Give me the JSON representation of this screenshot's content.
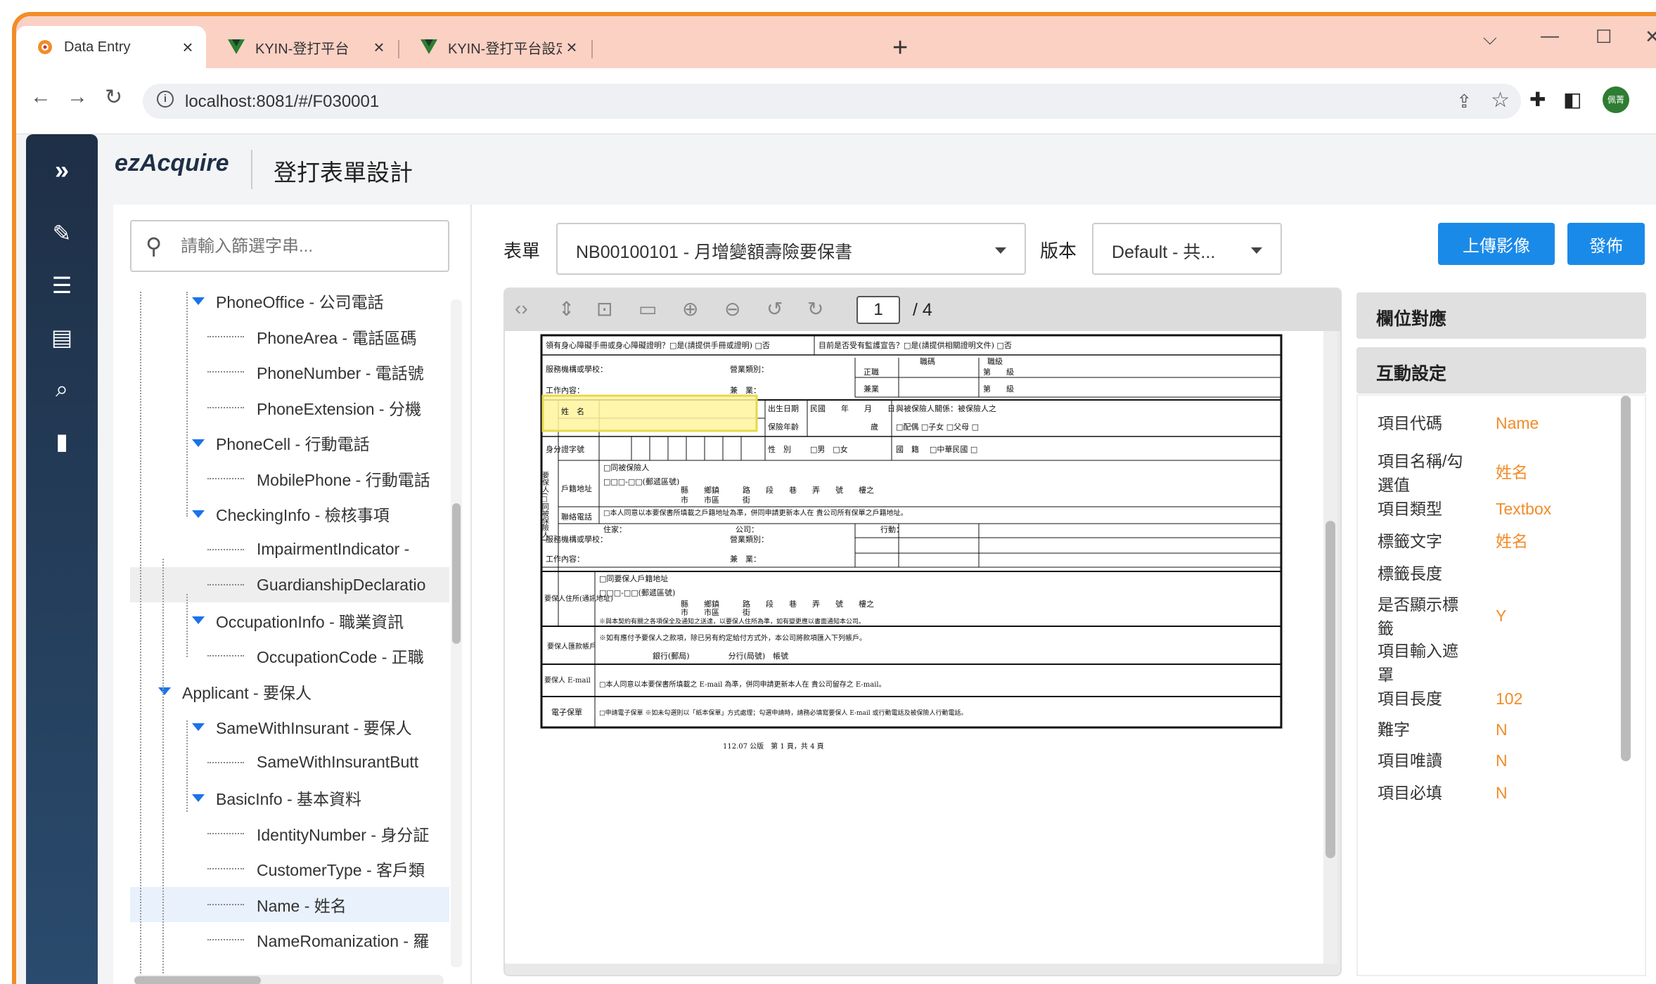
{
  "browser": {
    "tabs": [
      {
        "title": "Data Entry",
        "active": true
      },
      {
        "title": "KYIN-登打平台",
        "active": false
      },
      {
        "title": "KYIN-登打平台設定",
        "active": false
      }
    ],
    "new_tab_symbol": "+",
    "url": "localhost:8081/#/F030001",
    "profile_label": "佩菁"
  },
  "app": {
    "logo": "ezAcquire",
    "title": "登打表單設計"
  },
  "rail": {
    "icons": [
      "expand-icon",
      "edit-icon",
      "list-icon",
      "card-icon",
      "search-doc-icon",
      "file-icon"
    ]
  },
  "search": {
    "placeholder": "請輸入篩選字串..."
  },
  "tree": [
    {
      "label": "PhoneOffice - 公司電話",
      "level": 2,
      "caret": true
    },
    {
      "label": "PhoneArea - 電話區碼",
      "level": 3
    },
    {
      "label": "PhoneNumber - 電話號",
      "level": 3
    },
    {
      "label": "PhoneExtension - 分機",
      "level": 3
    },
    {
      "label": "PhoneCell - 行動電話",
      "level": 2,
      "caret": true
    },
    {
      "label": "MobilePhone - 行動電話",
      "level": 3
    },
    {
      "label": "CheckingInfo - 檢核事項",
      "level": 2,
      "caret": true
    },
    {
      "label": "ImpairmentIndicator - ",
      "level": 3
    },
    {
      "label": "GuardianshipDeclaratio",
      "level": 3,
      "hover": true
    },
    {
      "label": "OccupationInfo - 職業資訊",
      "level": 2,
      "caret": true
    },
    {
      "label": "OccupationCode - 正職",
      "level": 3
    },
    {
      "label": "Applicant - 要保人",
      "level": 1,
      "caret": true
    },
    {
      "label": "SameWithInsurant - 要保人",
      "level": 2,
      "caret": true
    },
    {
      "label": "SameWithInsurantButt",
      "level": 3
    },
    {
      "label": "BasicInfo - 基本資料",
      "level": 2,
      "caret": true
    },
    {
      "label": "IdentityNumber - 身分証",
      "level": 3
    },
    {
      "label": "CustomerType - 客戶類",
      "level": 3
    },
    {
      "label": "Name - 姓名",
      "level": 3,
      "selected": true
    },
    {
      "label": "NameRomanization - 羅",
      "level": 3
    }
  ],
  "toolbar": {
    "form_label": "表單",
    "form_value": "NB00100101 - 月增變額壽險要保書",
    "version_label": "版本",
    "version_value": "Default - 共...",
    "upload_button": "上傳影像",
    "publish_button": "發佈"
  },
  "viewer": {
    "current_page": "1",
    "total_pages": "/ 4"
  },
  "document": {
    "line1_left": "領有身心障礙手冊或身心障礙證明？□是(請提供手冊或證明) □否",
    "line1_right": "目前是否受有監護宣告？□是(請提供相關證明文件) □否",
    "employer": "服務機構或學校：",
    "industry": "營業類別：",
    "job_code": "職碼",
    "job_grade": "職級",
    "main_job": "正職",
    "side_job": "兼業",
    "work_content": "工作內容：",
    "duty": "兼　業：",
    "grade_unit": "第　　級",
    "name": "姓　名",
    "birth": "出生日期",
    "birth_value": "民國　　年　　月　　日",
    "age": "保險年齡",
    "age_unit": "歲",
    "relation": "與被保險人關係：被保險人之",
    "relation_options": "□配偶 □子女 □父母 □",
    "id": "身分證字號",
    "gender": "性　別",
    "gender_options": "□男　□女",
    "nationality": "國　籍",
    "nationality_options": "□中華民國 □",
    "applicant_side": "要保人(□同被保險人)",
    "same_insured": "□同被保險人",
    "postal": "□□□-□□(郵遞區號)",
    "household": "戶籍地址",
    "addr_parts": "縣　　鄉鎮　　　路　　段　　巷　　弄　　號　　樓之",
    "addr_parts2": "市　　市區　　　街",
    "agree_household": "□本人同意以本要保書所填載之戶籍地址為準，併同申請更新本人在 貴公司所有保單之戶籍地址。",
    "phone": "聯絡電話",
    "phone_home": "住家：",
    "phone_company": "公司：",
    "phone_mobile": "行動：",
    "residence": "要保人住所(通訊地址)",
    "same_applicant": "□同要保人戶籍地址",
    "notice": "※與本契約有關之各項保全及通知之送達，以要保人住所為準，如有變更應以書面通知本公司。",
    "bank_title": "要保人匯款帳戶",
    "bank_notice": "※如有應付予要保人之款項，除已另有約定給付方式外，本公司將款項匯入下列帳戶。",
    "bank_line": "銀行(郵局)　　　　　分行(局號)　帳號",
    "email_title": "要保人 E-mail",
    "email_text": "□本人同意以本要保書所填載之 E-mail 為準，併同申請更新本人在 貴公司留存之 E-mail。",
    "epolicy_title": "電子保單",
    "epolicy_text": "□申請電子保單 ※如未勾選則以「紙本保單」方式處理；勾選申請時，請務必填寫要保人 E-mail 或行動電話及被保險人行動電話。",
    "footer": "112.07 公版　第 1 頁，共 4 頁"
  },
  "props": {
    "mapping_header": "欄位對應",
    "interaction_header": "互動設定",
    "rows": [
      {
        "label": "項目代碼",
        "value": "Name"
      },
      {
        "label": "項目名稱/勾選值",
        "value": "姓名"
      },
      {
        "label": "項目類型",
        "value": "Textbox"
      },
      {
        "label": "標籤文字",
        "value": "姓名"
      },
      {
        "label": "標籤長度",
        "value": ""
      },
      {
        "label": "是否顯示標籤",
        "value": "Y"
      },
      {
        "label": "項目輸入遮罩",
        "value": ""
      },
      {
        "label": "項目長度",
        "value": "102"
      },
      {
        "label": "難字",
        "value": "N"
      },
      {
        "label": "項目唯讀",
        "value": "N"
      },
      {
        "label": "項目必填",
        "value": "N"
      }
    ]
  },
  "colors": {
    "accent": "#1a8ae8",
    "value_orange": "#f28c28",
    "highlight": "#fff59d",
    "browser_frame": "#f28c28",
    "rail": "#1e2f46"
  }
}
